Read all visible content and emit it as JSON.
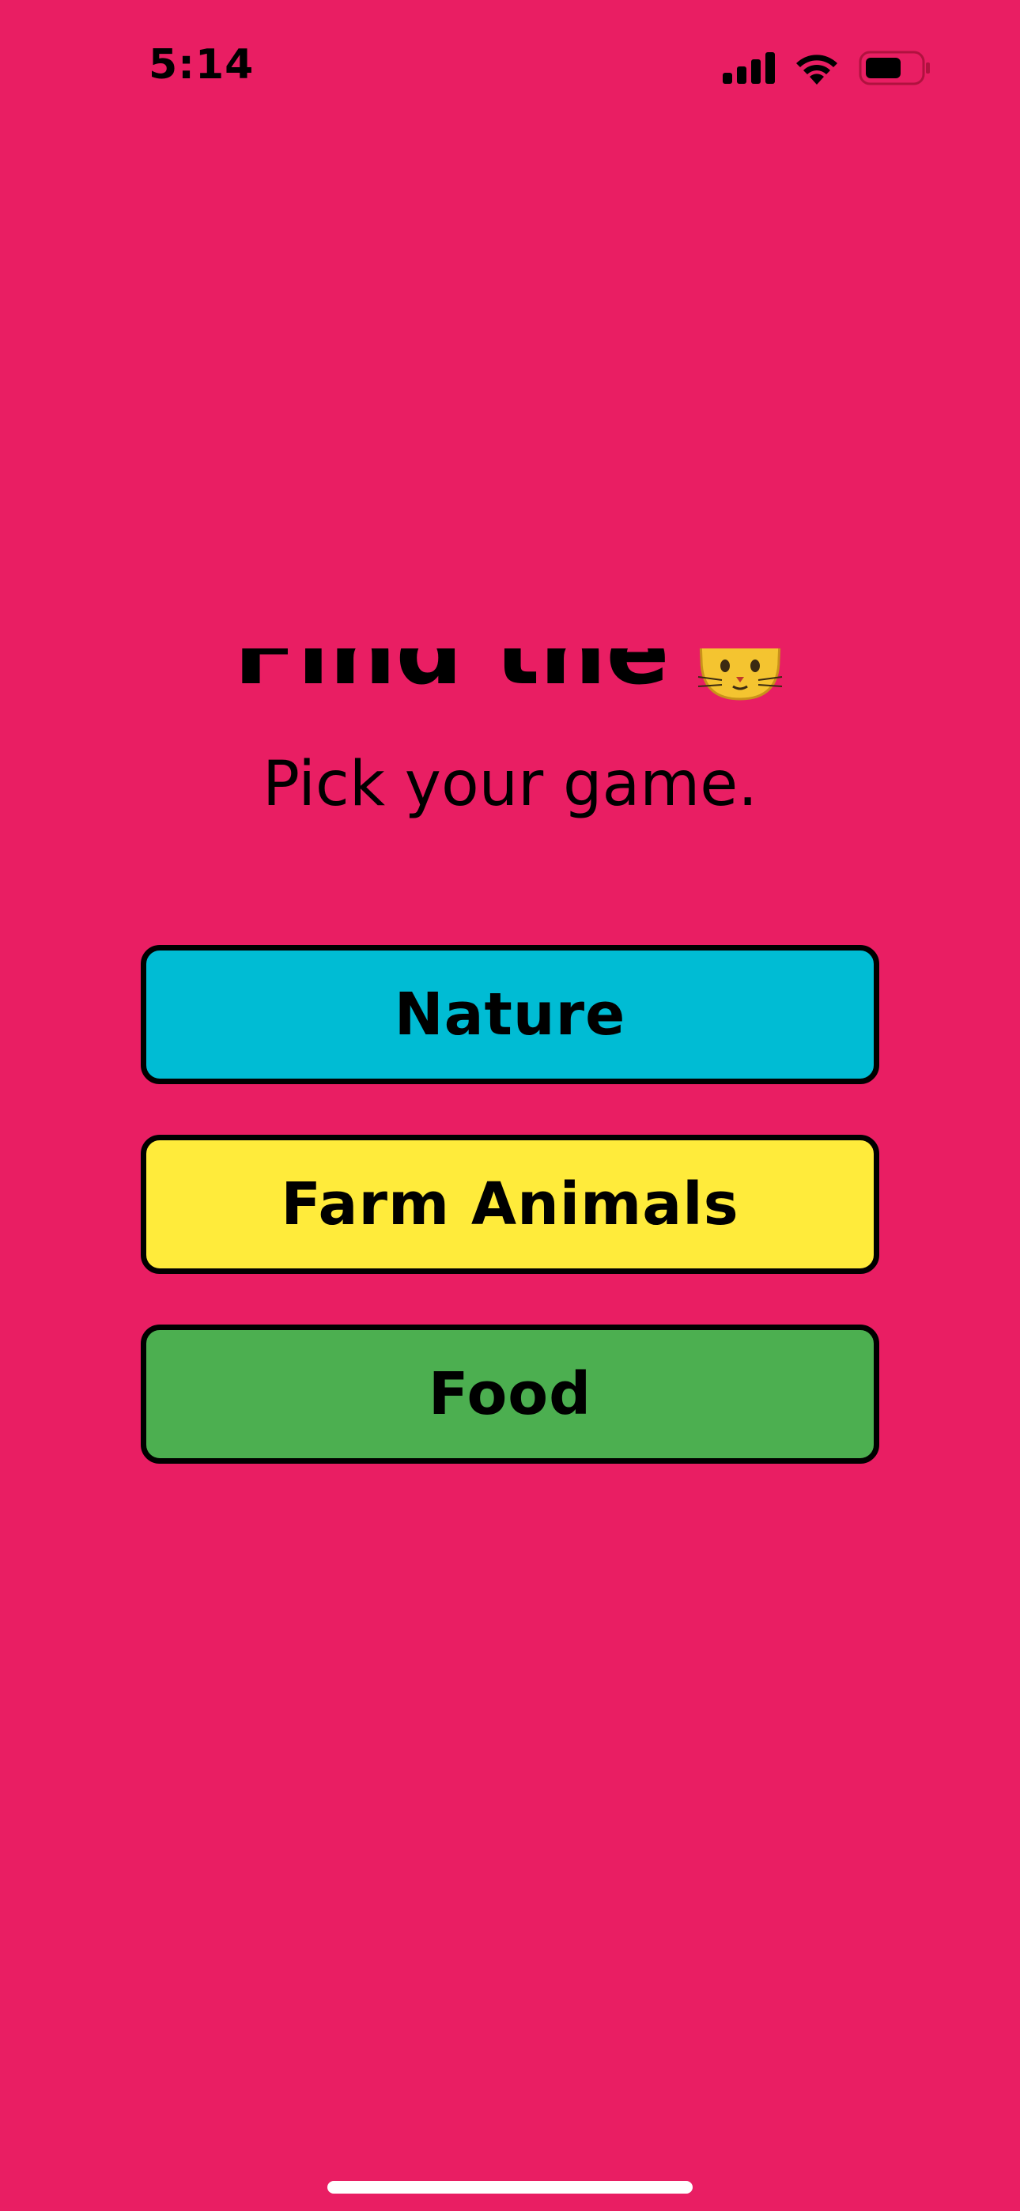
{
  "status_bar": {
    "time": "5:14"
  },
  "header": {
    "title": "Find the",
    "title_icon": "cat-face-emoji",
    "subtitle": "Pick your game."
  },
  "games": [
    {
      "label": "Nature",
      "color": "#00BCD4"
    },
    {
      "label": "Farm Animals",
      "color": "#FFEB3B"
    },
    {
      "label": "Food",
      "color": "#4CAF50"
    }
  ],
  "colors": {
    "background": "#E91E63",
    "text": "#000000",
    "button_border": "#000000"
  }
}
